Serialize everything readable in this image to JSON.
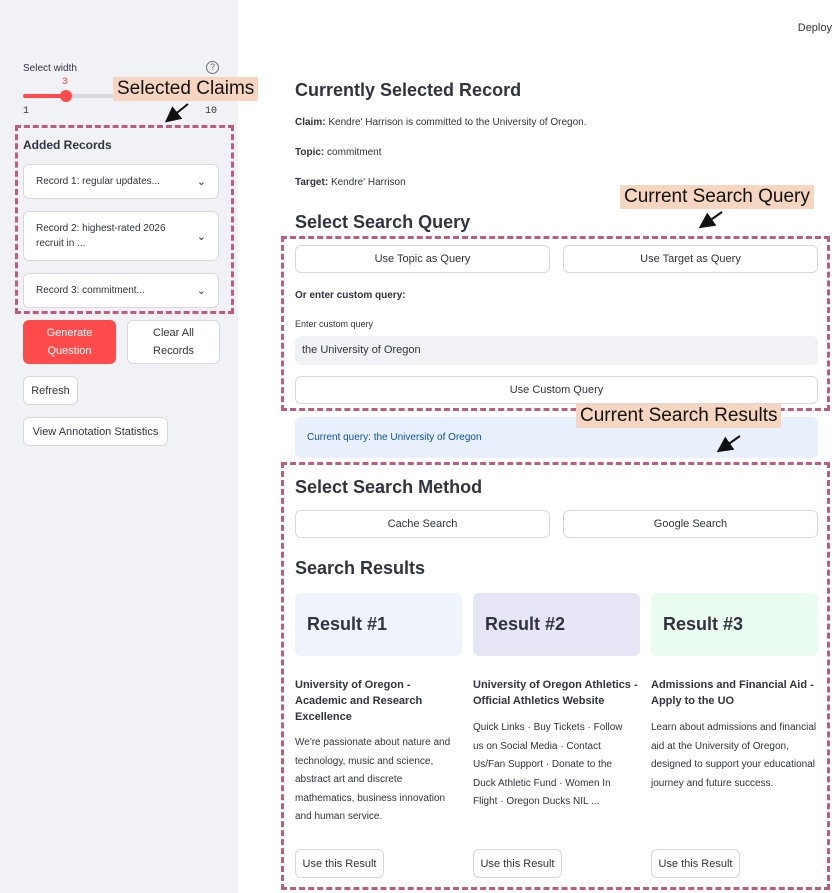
{
  "header": {
    "deploy_label": "Deploy"
  },
  "sidebar": {
    "slider": {
      "label": "Select width",
      "value": "3",
      "min": "1",
      "max": "10",
      "help_icon": "question-circle-icon",
      "accent": "#ff4b4b"
    },
    "added_records_heading": "Added Records",
    "records": [
      {
        "label": "Record 1: regular updates...",
        "icon": "chevron-down-icon"
      },
      {
        "label": "Record 2: highest-rated 2026 recruit in ...",
        "icon": "chevron-down-icon"
      },
      {
        "label": "Record 3: commitment...",
        "icon": "chevron-down-icon"
      }
    ],
    "buttons": {
      "generate_question": "Generate Question",
      "clear_all_records": "Clear All Records",
      "refresh": "Refresh",
      "view_stats": "View Annotation Statistics"
    }
  },
  "main": {
    "selected_record": {
      "title": "Currently Selected Record",
      "claim_key": "Claim:",
      "claim_value": "Kendre' Harrison is committed to the University of Oregon.",
      "topic_key": "Topic:",
      "topic_value": "commitment",
      "target_key": "Target:",
      "target_value": "Kendre' Harrison"
    },
    "search_query": {
      "title": "Select Search Query",
      "use_topic": "Use Topic as Query",
      "use_target": "Use Target as Query",
      "custom_heading": "Or enter custom query:",
      "input_label": "Enter custom query",
      "input_value": "the University of Oregon",
      "use_custom": "Use Custom Query",
      "current_query": "Current query: the University of Oregon"
    },
    "search_method": {
      "title": "Select Search Method",
      "cache": "Cache Search",
      "google": "Google Search"
    },
    "results": {
      "title": "Search Results",
      "use_result_label": "Use this Result",
      "items": [
        {
          "card": "Result #1",
          "title": "University of Oregon - Academic and Research Excellence",
          "desc": "We're passionate about nature and technology, music and science, abstract art and discrete mathematics, business innovation and human service.",
          "color": "#eef3fc"
        },
        {
          "card": "Result #2",
          "title": "University of Oregon Athletics - Official Athletics Website",
          "desc": "Quick Links · Buy Tickets · Follow us on Social Media · Contact Us/Fan Support · Donate to the Duck Athletic Fund · Women In Flight · Oregon Ducks NIL ...",
          "color": "#e6e6f6"
        },
        {
          "card": "Result #3",
          "title": "Admissions and Financial Aid - Apply to the UO",
          "desc": "Learn about admissions and financial aid at the University of Oregon, designed to support your educational journey and future success.",
          "color": "#eafbef"
        }
      ]
    }
  },
  "annotations": {
    "selected_claims": "Selected Claims",
    "current_search_query": "Current Search Query",
    "current_search_results": "Current Search Results",
    "box_color": "#c05b7f",
    "label_bg": "#f6d6c0"
  }
}
